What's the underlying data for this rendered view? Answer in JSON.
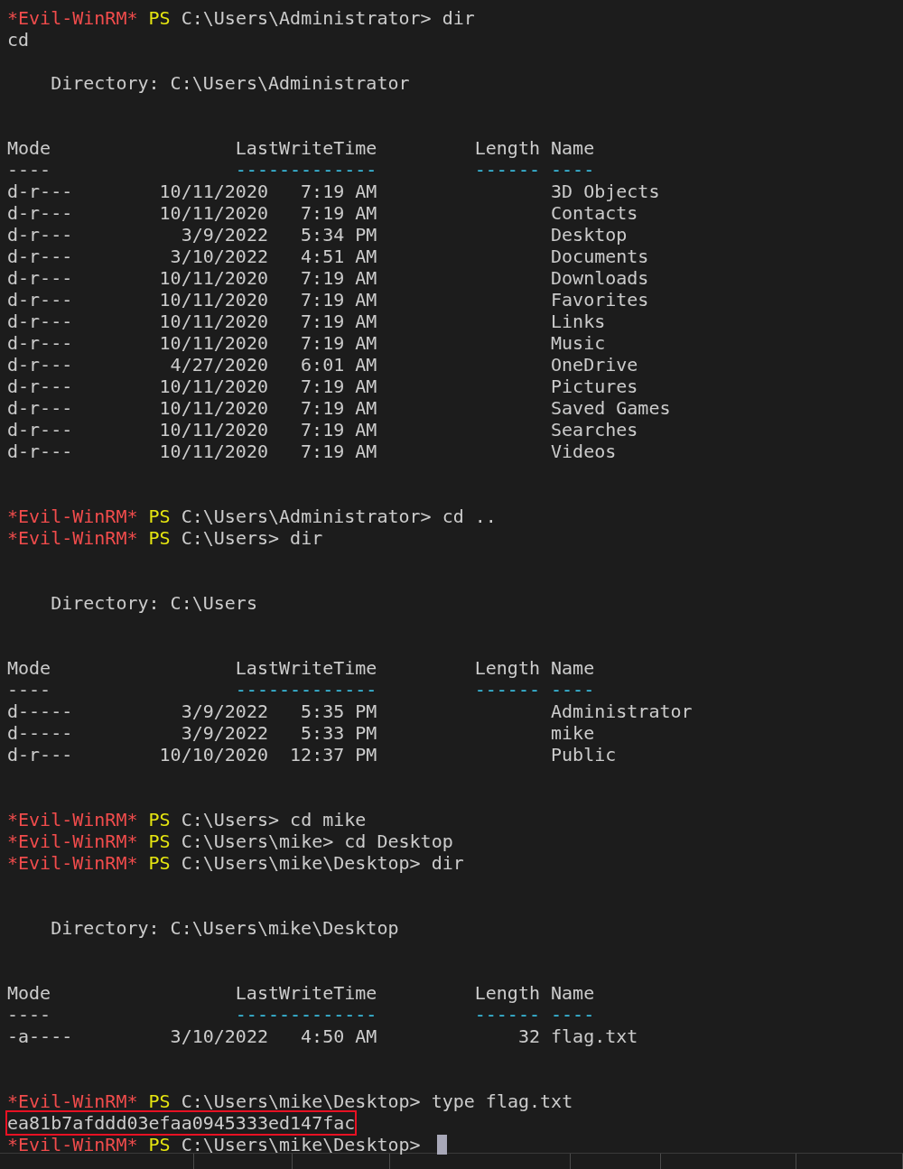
{
  "terminal": {
    "lines": [
      {
        "kind": "prompt",
        "tag": "*Evil-WinRM*",
        "shell": "PS",
        "path": "C:\\Users\\Administrator>",
        "command": "dir",
        "cursor": false
      },
      {
        "kind": "text",
        "text": "cd",
        "highlighted": false
      },
      {
        "kind": "blank"
      },
      {
        "kind": "directory",
        "text": "Directory: C:\\Users\\Administrator"
      },
      {
        "kind": "blank"
      },
      {
        "kind": "blank"
      },
      {
        "kind": "table",
        "columns": [
          "Mode",
          "LastWriteTime",
          "Length",
          "Name"
        ],
        "rules": [
          "----",
          "-------------",
          "------",
          "----"
        ],
        "rows": [
          {
            "mode": "d-r---",
            "date": "10/11/2020",
            "time": "7:19 AM",
            "length": "",
            "name": "3D Objects"
          },
          {
            "mode": "d-r---",
            "date": "10/11/2020",
            "time": "7:19 AM",
            "length": "",
            "name": "Contacts"
          },
          {
            "mode": "d-r---",
            "date": "3/9/2022",
            "time": "5:34 PM",
            "length": "",
            "name": "Desktop"
          },
          {
            "mode": "d-r---",
            "date": "3/10/2022",
            "time": "4:51 AM",
            "length": "",
            "name": "Documents"
          },
          {
            "mode": "d-r---",
            "date": "10/11/2020",
            "time": "7:19 AM",
            "length": "",
            "name": "Downloads"
          },
          {
            "mode": "d-r---",
            "date": "10/11/2020",
            "time": "7:19 AM",
            "length": "",
            "name": "Favorites"
          },
          {
            "mode": "d-r---",
            "date": "10/11/2020",
            "time": "7:19 AM",
            "length": "",
            "name": "Links"
          },
          {
            "mode": "d-r---",
            "date": "10/11/2020",
            "time": "7:19 AM",
            "length": "",
            "name": "Music"
          },
          {
            "mode": "d-r---",
            "date": "4/27/2020",
            "time": "6:01 AM",
            "length": "",
            "name": "OneDrive"
          },
          {
            "mode": "d-r---",
            "date": "10/11/2020",
            "time": "7:19 AM",
            "length": "",
            "name": "Pictures"
          },
          {
            "mode": "d-r---",
            "date": "10/11/2020",
            "time": "7:19 AM",
            "length": "",
            "name": "Saved Games"
          },
          {
            "mode": "d-r---",
            "date": "10/11/2020",
            "time": "7:19 AM",
            "length": "",
            "name": "Searches"
          },
          {
            "mode": "d-r---",
            "date": "10/11/2020",
            "time": "7:19 AM",
            "length": "",
            "name": "Videos"
          }
        ]
      },
      {
        "kind": "blank"
      },
      {
        "kind": "blank"
      },
      {
        "kind": "prompt",
        "tag": "*Evil-WinRM*",
        "shell": "PS",
        "path": "C:\\Users\\Administrator>",
        "command": "cd ..",
        "cursor": false
      },
      {
        "kind": "prompt",
        "tag": "*Evil-WinRM*",
        "shell": "PS",
        "path": "C:\\Users>",
        "command": "dir",
        "cursor": false
      },
      {
        "kind": "blank"
      },
      {
        "kind": "blank"
      },
      {
        "kind": "directory",
        "text": "Directory: C:\\Users"
      },
      {
        "kind": "blank"
      },
      {
        "kind": "blank"
      },
      {
        "kind": "table",
        "columns": [
          "Mode",
          "LastWriteTime",
          "Length",
          "Name"
        ],
        "rules": [
          "----",
          "-------------",
          "------",
          "----"
        ],
        "rows": [
          {
            "mode": "d-----",
            "date": "3/9/2022",
            "time": "5:35 PM",
            "length": "",
            "name": "Administrator"
          },
          {
            "mode": "d-----",
            "date": "3/9/2022",
            "time": "5:33 PM",
            "length": "",
            "name": "mike"
          },
          {
            "mode": "d-r---",
            "date": "10/10/2020",
            "time": "12:37 PM",
            "length": "",
            "name": "Public"
          }
        ]
      },
      {
        "kind": "blank"
      },
      {
        "kind": "blank"
      },
      {
        "kind": "prompt",
        "tag": "*Evil-WinRM*",
        "shell": "PS",
        "path": "C:\\Users>",
        "command": "cd mike",
        "cursor": false
      },
      {
        "kind": "prompt",
        "tag": "*Evil-WinRM*",
        "shell": "PS",
        "path": "C:\\Users\\mike>",
        "command": "cd Desktop",
        "cursor": false
      },
      {
        "kind": "prompt",
        "tag": "*Evil-WinRM*",
        "shell": "PS",
        "path": "C:\\Users\\mike\\Desktop>",
        "command": "dir",
        "cursor": false
      },
      {
        "kind": "blank"
      },
      {
        "kind": "blank"
      },
      {
        "kind": "directory",
        "text": "Directory: C:\\Users\\mike\\Desktop"
      },
      {
        "kind": "blank"
      },
      {
        "kind": "blank"
      },
      {
        "kind": "table",
        "columns": [
          "Mode",
          "LastWriteTime",
          "Length",
          "Name"
        ],
        "rules": [
          "----",
          "-------------",
          "------",
          "----"
        ],
        "rows": [
          {
            "mode": "-a----",
            "date": "3/10/2022",
            "time": "4:50 AM",
            "length": "32",
            "name": "flag.txt"
          }
        ]
      },
      {
        "kind": "blank"
      },
      {
        "kind": "blank"
      },
      {
        "kind": "prompt",
        "tag": "*Evil-WinRM*",
        "shell": "PS",
        "path": "C:\\Users\\mike\\Desktop>",
        "command": "type flag.txt",
        "cursor": false
      },
      {
        "kind": "text",
        "text": "ea81b7afddd03efaa0945333ed147fac",
        "highlighted": true
      },
      {
        "kind": "prompt",
        "tag": "*Evil-WinRM*",
        "shell": "PS",
        "path": "C:\\Users\\mike\\Desktop>",
        "cursor": true
      }
    ]
  }
}
